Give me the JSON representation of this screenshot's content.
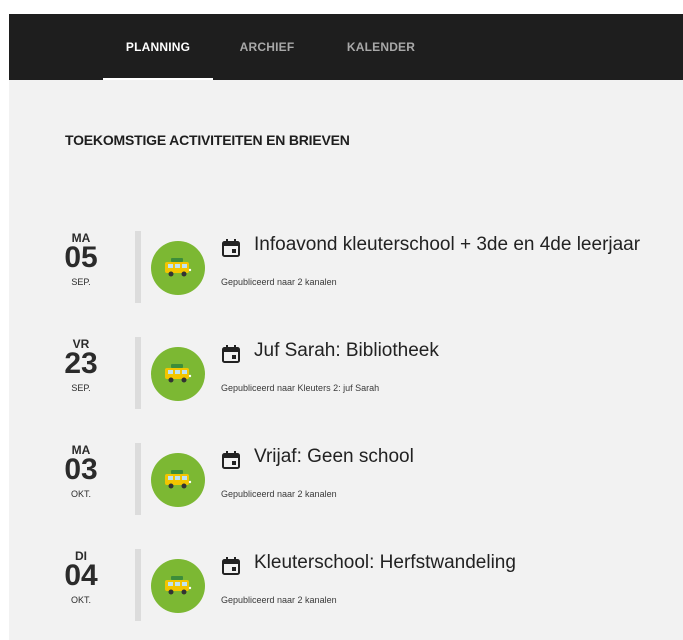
{
  "nav": {
    "tabs": [
      {
        "label": "PLANNING",
        "active": true
      },
      {
        "label": "ARCHIEF",
        "active": false
      },
      {
        "label": "KALENDER",
        "active": false
      }
    ]
  },
  "section": {
    "title": "TOEKOMSTIGE ACTIVITEITEN EN BRIEVEN"
  },
  "items": [
    {
      "dow": "MA",
      "day": "05",
      "month": "SEP.",
      "title": "Infoavond kleuterschool + 3de en 4de leerjaar",
      "meta": "Gepubliceerd naar 2 kanalen",
      "icon": "calendar-icon"
    },
    {
      "dow": "VR",
      "day": "23",
      "month": "SEP.",
      "title": "Juf Sarah: Bibliotheek",
      "meta": "Gepubliceerd naar Kleuters 2: juf Sarah",
      "icon": "calendar-icon"
    },
    {
      "dow": "MA",
      "day": "03",
      "month": "OKT.",
      "title": "Vrijaf: Geen school",
      "meta": "Gepubliceerd naar 2 kanalen",
      "icon": "calendar-icon"
    },
    {
      "dow": "DI",
      "day": "04",
      "month": "OKT.",
      "title": "Kleuterschool: Herfstwandeling",
      "meta": "Gepubliceerd naar 2 kanalen",
      "icon": "calendar-icon"
    }
  ],
  "colors": {
    "topbar": "#1e1e1e",
    "background": "#f2f2f2",
    "avatar": "#7cb833",
    "bus": "#f2c500"
  }
}
